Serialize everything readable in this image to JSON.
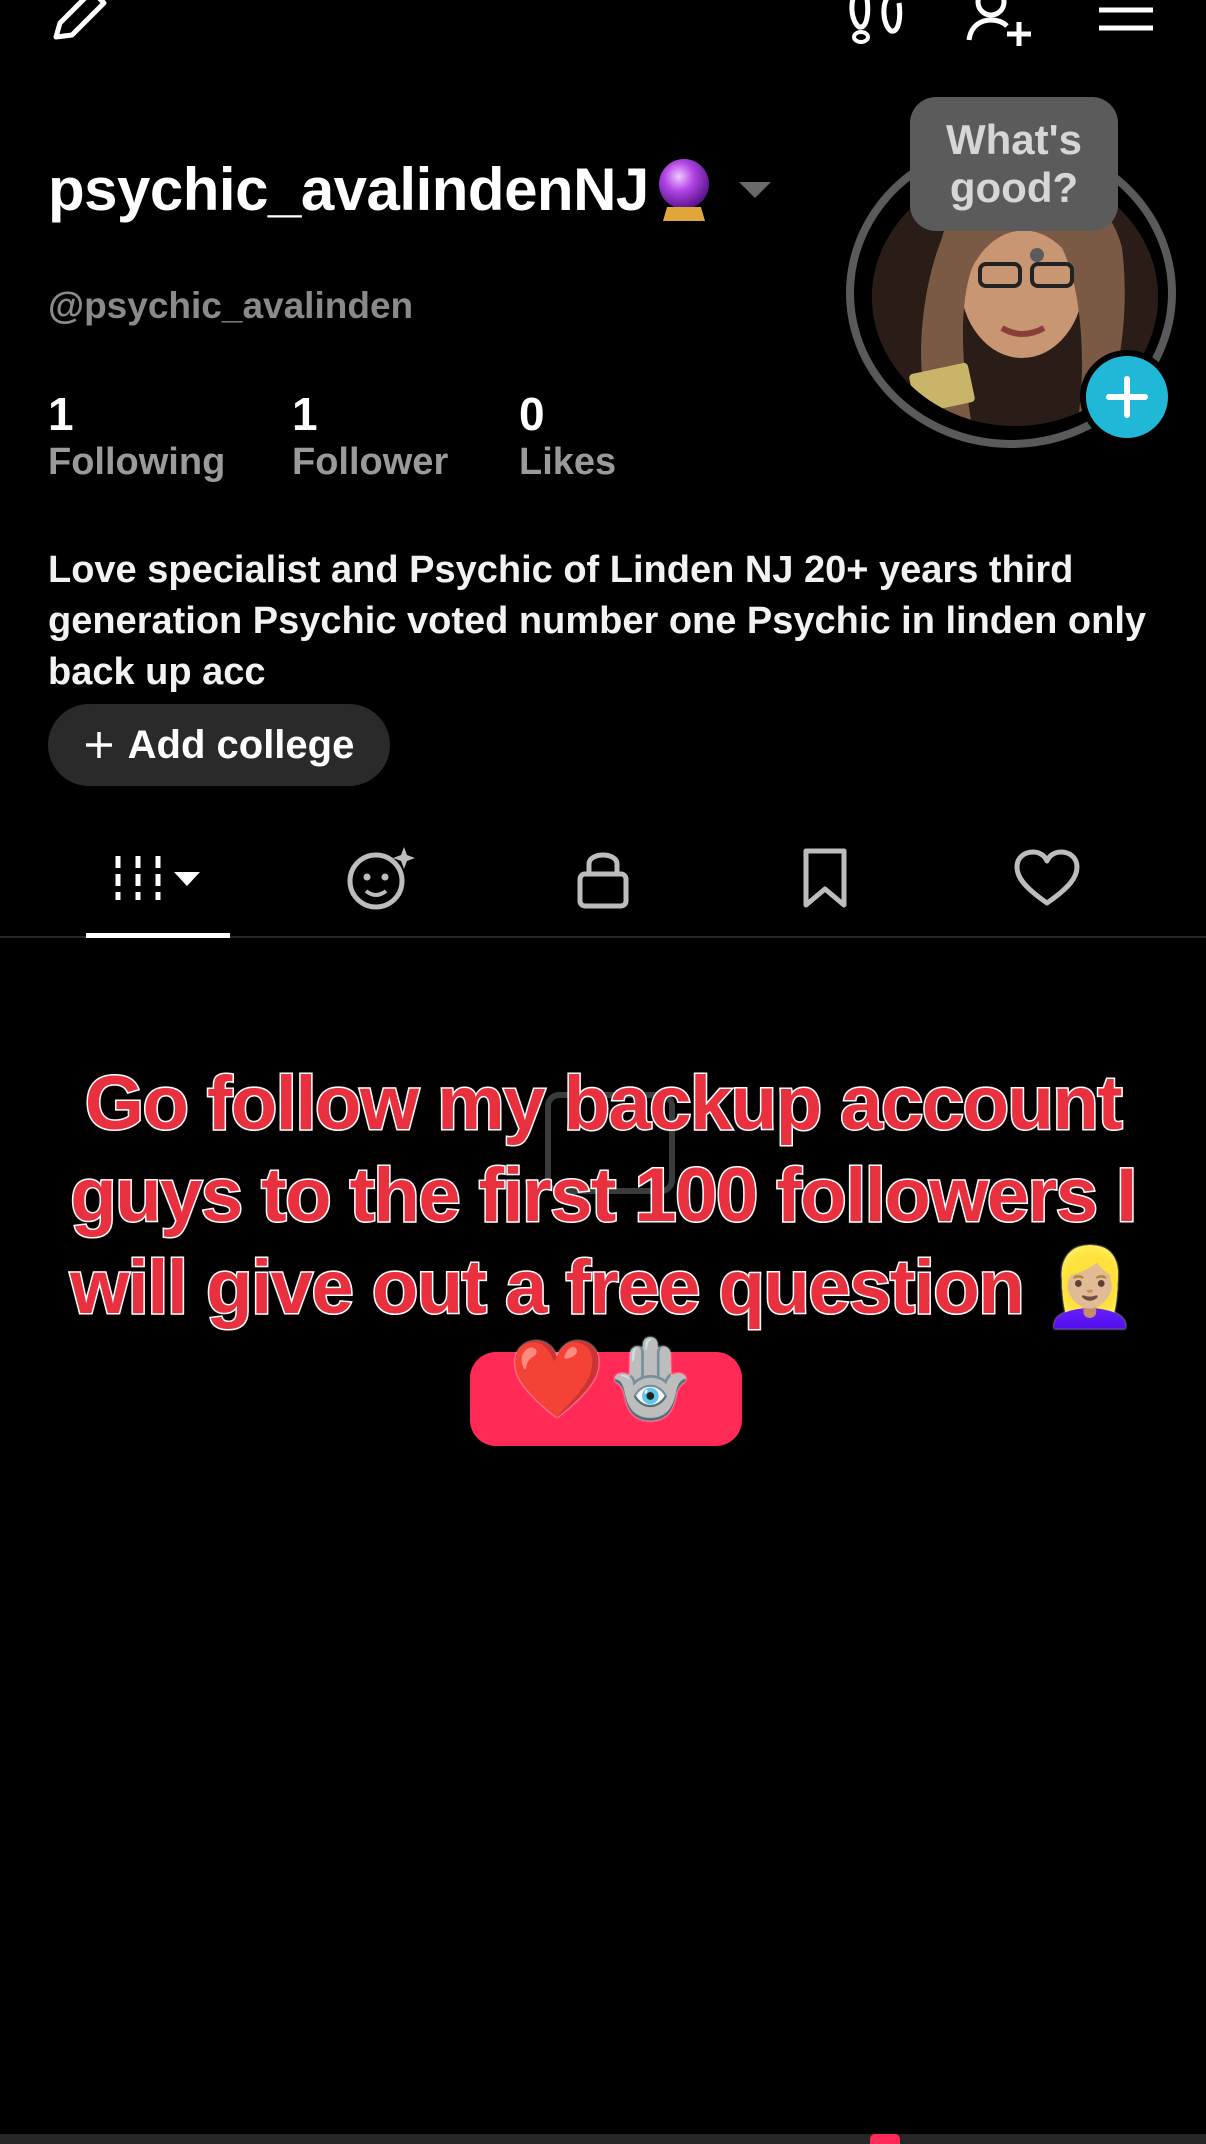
{
  "topbar": {
    "edit_icon": "pencil-icon",
    "footprint_icon": "footprints-icon",
    "add_friend_icon": "add-user-icon",
    "menu_icon": "hamburger-menu-icon"
  },
  "profile": {
    "display_name": "psychic_avalindenNJ",
    "handle": "@psychic_avalinden",
    "story_bubble": "What's good?",
    "stats": [
      {
        "value": "1",
        "label": "Following"
      },
      {
        "value": "1",
        "label": "Follower"
      },
      {
        "value": "0",
        "label": "Likes"
      }
    ],
    "bio": "Love specialist and Psychic of Linden NJ 20+ years third generation Psychic voted number one Psychic in linden only back up acc",
    "add_college_label": "Add college",
    "accent_color": "#21b7d6"
  },
  "tabs": [
    {
      "name": "videos",
      "icon": "grid-columns-icon",
      "active": true
    },
    {
      "name": "reposts",
      "icon": "sparkle-face-icon",
      "active": false
    },
    {
      "name": "private",
      "icon": "lock-icon",
      "active": false
    },
    {
      "name": "favorites",
      "icon": "bookmark-icon",
      "active": false
    },
    {
      "name": "liked",
      "icon": "heart-icon",
      "active": false
    }
  ],
  "overlay": {
    "caption": "Go follow my backup account guys to the first 100 followers I will give out a free question 👱🏼‍♀️❤️🪬",
    "caption_color": "#e8303f"
  }
}
